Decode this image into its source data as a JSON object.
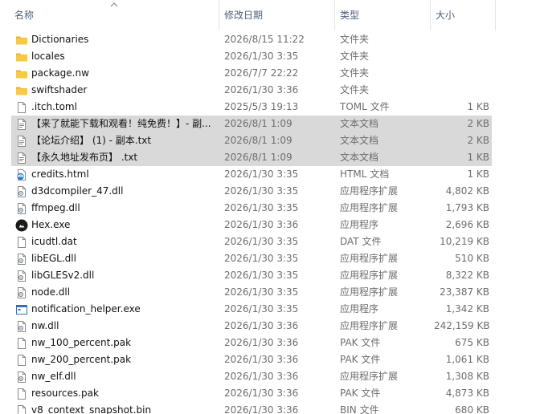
{
  "columns": {
    "name": "名称",
    "date": "修改日期",
    "type": "类型",
    "size": "大小"
  },
  "files": [
    {
      "name": "Dictionaries",
      "date": "2026/8/15 11:22",
      "type": "文件夹",
      "size": "",
      "icon": "folder-icon",
      "selected": false
    },
    {
      "name": "locales",
      "date": "2026/1/30 3:35",
      "type": "文件夹",
      "size": "",
      "icon": "folder-icon",
      "selected": false
    },
    {
      "name": "package.nw",
      "date": "2026/7/7 22:22",
      "type": "文件夹",
      "size": "",
      "icon": "folder-icon",
      "selected": false
    },
    {
      "name": "swiftshader",
      "date": "2026/1/30 3:36",
      "type": "文件夹",
      "size": "",
      "icon": "folder-icon",
      "selected": false
    },
    {
      "name": ".itch.toml",
      "date": "2025/5/3 19:13",
      "type": "TOML 文件",
      "size": "1 KB",
      "icon": "file-icon",
      "selected": false
    },
    {
      "name": "【来了就能下载和观看！纯免费！】- 副...",
      "date": "2026/8/1 1:09",
      "type": "文本文档",
      "size": "2 KB",
      "icon": "text-file-icon",
      "selected": true
    },
    {
      "name": "【论坛介绍】 (1) - 副本.txt",
      "date": "2026/8/1 1:09",
      "type": "文本文档",
      "size": "2 KB",
      "icon": "text-file-icon",
      "selected": true
    },
    {
      "name": "【永久地址发布页】 .txt",
      "date": "2026/8/1 1:09",
      "type": "文本文档",
      "size": "1 KB",
      "icon": "text-file-icon",
      "selected": true
    },
    {
      "name": "credits.html",
      "date": "2026/1/30 3:35",
      "type": "HTML 文档",
      "size": "1 KB",
      "icon": "html-file-icon",
      "selected": false
    },
    {
      "name": "d3dcompiler_47.dll",
      "date": "2026/1/30 3:35",
      "type": "应用程序扩展",
      "size": "4,802 KB",
      "icon": "dll-file-icon",
      "selected": false
    },
    {
      "name": "ffmpeg.dll",
      "date": "2026/1/30 3:35",
      "type": "应用程序扩展",
      "size": "1,793 KB",
      "icon": "dll-file-icon",
      "selected": false
    },
    {
      "name": "Hex.exe",
      "date": "2026/1/30 3:36",
      "type": "应用程序",
      "size": "2,696 KB",
      "icon": "app-exe-icon",
      "selected": false
    },
    {
      "name": "icudtl.dat",
      "date": "2026/1/30 3:35",
      "type": "DAT 文件",
      "size": "10,219 KB",
      "icon": "file-icon",
      "selected": false
    },
    {
      "name": "libEGL.dll",
      "date": "2026/1/30 3:35",
      "type": "应用程序扩展",
      "size": "510 KB",
      "icon": "dll-file-icon",
      "selected": false
    },
    {
      "name": "libGLESv2.dll",
      "date": "2026/1/30 3:35",
      "type": "应用程序扩展",
      "size": "8,322 KB",
      "icon": "dll-file-icon",
      "selected": false
    },
    {
      "name": "node.dll",
      "date": "2026/1/30 3:35",
      "type": "应用程序扩展",
      "size": "23,387 KB",
      "icon": "dll-file-icon",
      "selected": false
    },
    {
      "name": "notification_helper.exe",
      "date": "2026/1/30 3:35",
      "type": "应用程序",
      "size": "1,342 KB",
      "icon": "exe-window-icon",
      "selected": false
    },
    {
      "name": "nw.dll",
      "date": "2026/1/30 3:36",
      "type": "应用程序扩展",
      "size": "242,159 KB",
      "icon": "dll-file-icon",
      "selected": false
    },
    {
      "name": "nw_100_percent.pak",
      "date": "2026/1/30 3:36",
      "type": "PAK 文件",
      "size": "675 KB",
      "icon": "file-icon",
      "selected": false
    },
    {
      "name": "nw_200_percent.pak",
      "date": "2026/1/30 3:36",
      "type": "PAK 文件",
      "size": "1,061 KB",
      "icon": "file-icon",
      "selected": false
    },
    {
      "name": "nw_elf.dll",
      "date": "2026/1/30 3:36",
      "type": "应用程序扩展",
      "size": "1,308 KB",
      "icon": "dll-file-icon",
      "selected": false
    },
    {
      "name": "resources.pak",
      "date": "2026/1/30 3:36",
      "type": "PAK 文件",
      "size": "4,873 KB",
      "icon": "file-icon",
      "selected": false
    },
    {
      "name": "v8_context_snapshot.bin",
      "date": "2026/1/30 3:36",
      "type": "BIN 文件",
      "size": "680 KB",
      "icon": "file-icon",
      "selected": false
    }
  ],
  "colors": {
    "folder": "#f8c948",
    "selection": "#d9d9d9",
    "header_text": "#4c607a"
  }
}
